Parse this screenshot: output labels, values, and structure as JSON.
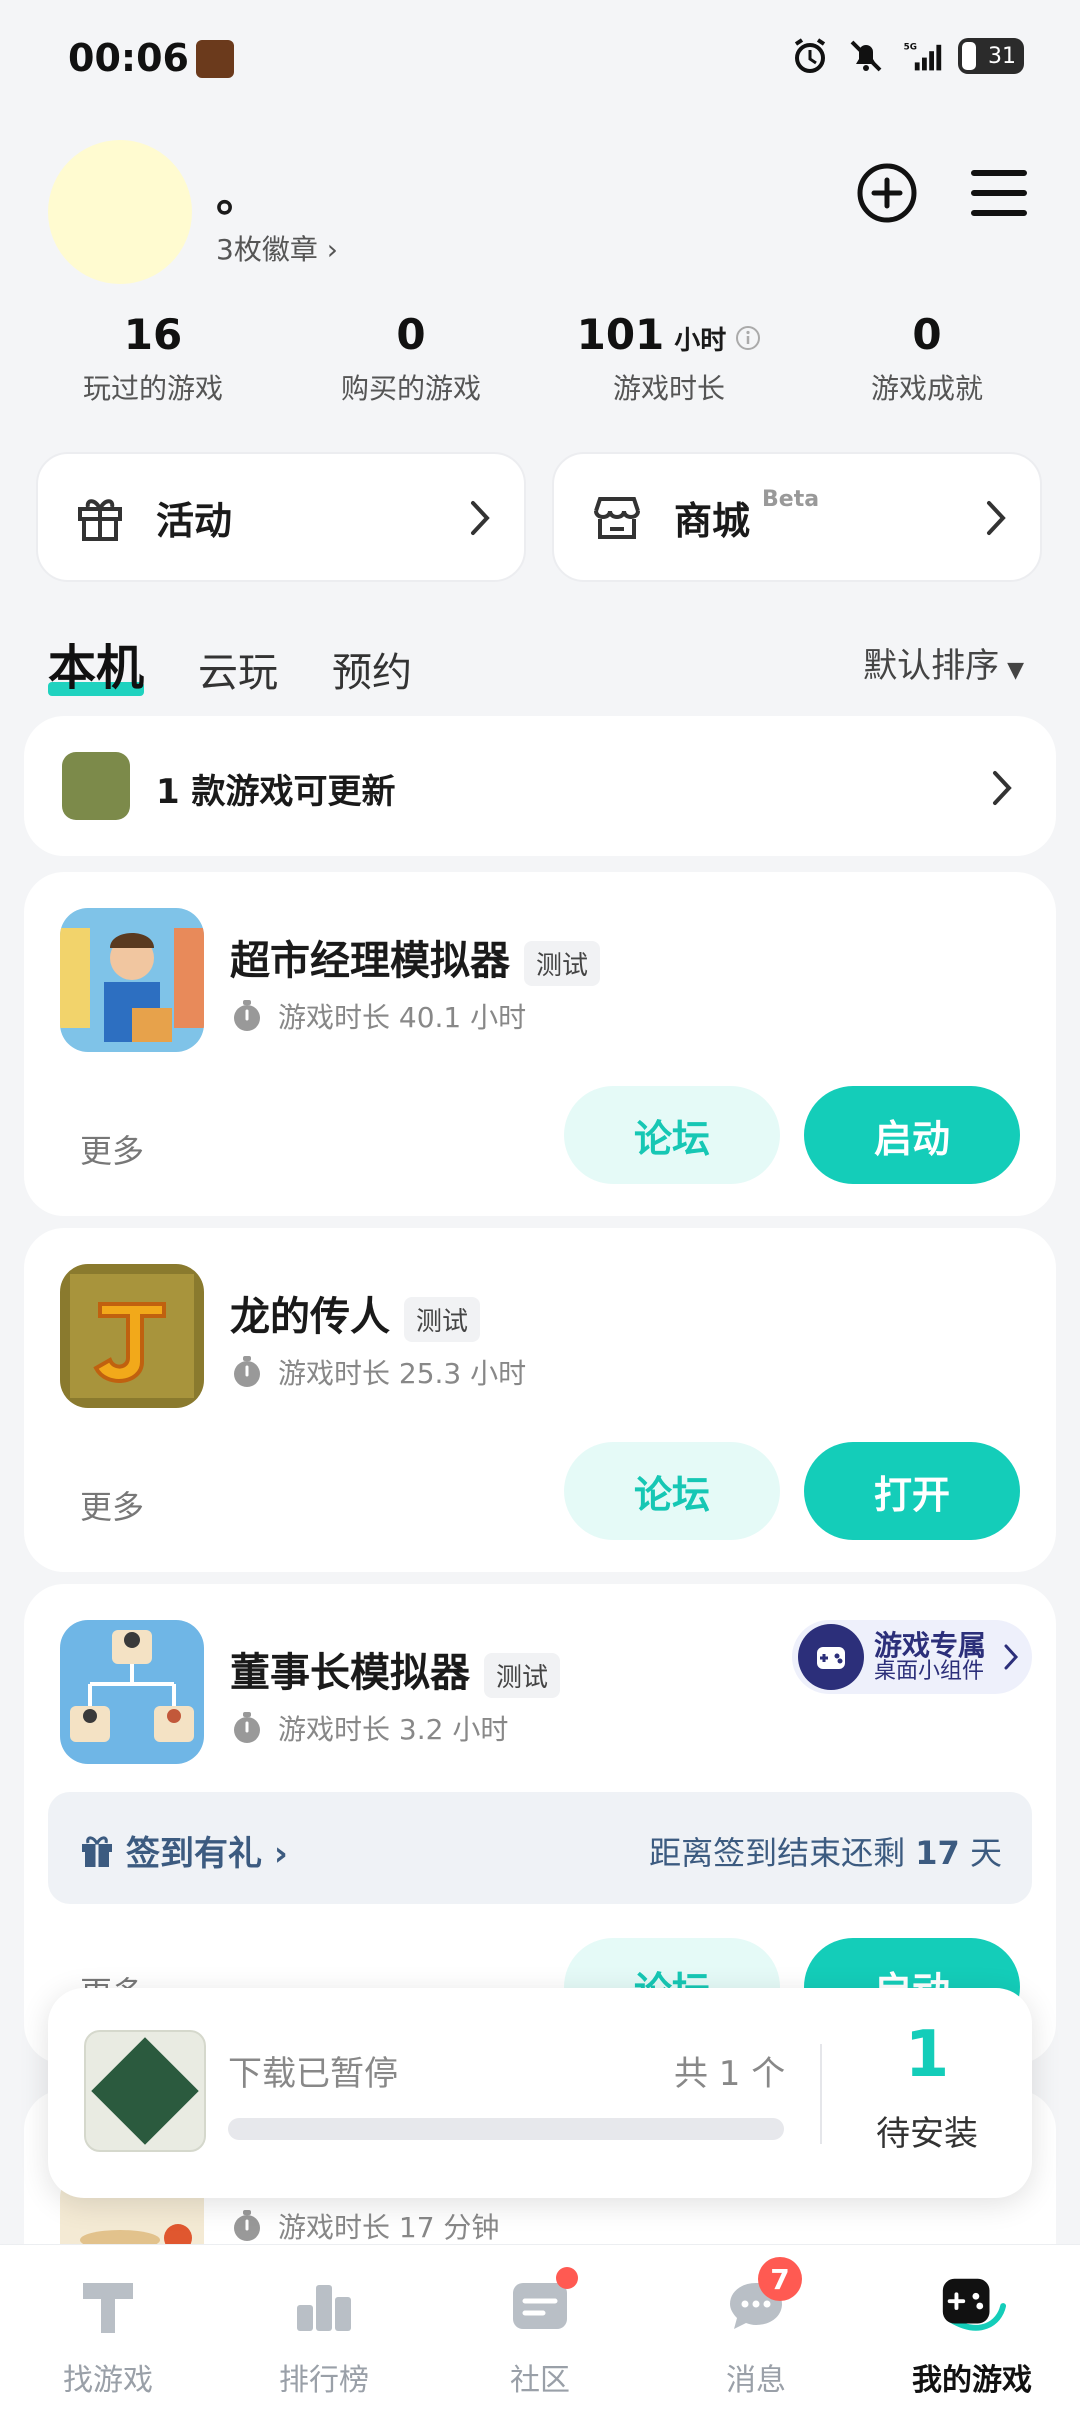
{
  "status_bar": {
    "time": "00:06",
    "network": "5G",
    "battery": "31"
  },
  "profile": {
    "username": "。",
    "badges": "3枚徽章 ›"
  },
  "stats": [
    {
      "value": "16",
      "unit": "",
      "label": "玩过的游戏"
    },
    {
      "value": "0",
      "unit": "",
      "label": "购买的游戏"
    },
    {
      "value": "101",
      "unit": "小时",
      "label": "游戏时长"
    },
    {
      "value": "0",
      "unit": "",
      "label": "游戏成就"
    }
  ],
  "entries": {
    "activity": "活动",
    "mall": "商城",
    "mall_tag": "Beta"
  },
  "tabs": [
    "本机",
    "云玩",
    "预约"
  ],
  "sort": {
    "label": "默认排序"
  },
  "update_card": {
    "text": "1 款游戏可更新"
  },
  "games": [
    {
      "title": "超市经理模拟器",
      "tag": "测试",
      "playtime": "游戏时长 40.1 小时",
      "more": "更多",
      "forum": "论坛",
      "action": "启动"
    },
    {
      "title": "龙的传人",
      "tag": "测试",
      "playtime": "游戏时长 25.3 小时",
      "more": "更多",
      "forum": "论坛",
      "action": "打开"
    },
    {
      "title": "董事长模拟器",
      "tag": "测试",
      "playtime": "游戏时长 3.2 小时",
      "more": "更多",
      "forum": "论坛",
      "action": "启动",
      "widget_title": "游戏专属",
      "widget_sub": "桌面小组件",
      "signin_left": "签到有礼 ›",
      "signin_right_prefix": "距离签到结束还剩 ",
      "signin_days": "17",
      "signin_right_suffix": " 天"
    },
    {
      "playtime": "游戏时长 17 分钟"
    }
  ],
  "download": {
    "status": "下载已暂停",
    "count": "共 1 个",
    "progress": 0,
    "pending_num": "1",
    "pending_label": "待安装"
  },
  "bottom_nav": [
    {
      "label": "找游戏"
    },
    {
      "label": "排行榜"
    },
    {
      "label": "社区"
    },
    {
      "label": "消息",
      "badge": "7"
    },
    {
      "label": "我的游戏"
    }
  ],
  "colors": {
    "accent": "#14cdb9",
    "accent_light": "#e5faf7",
    "badge_red": "#ff5a52"
  }
}
